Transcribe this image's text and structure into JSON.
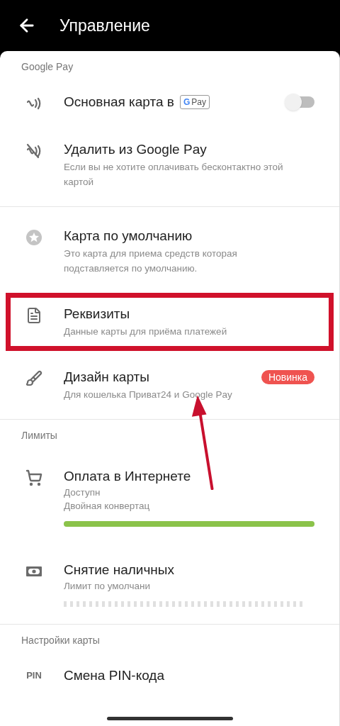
{
  "header": {
    "title": "Управление"
  },
  "sections": [
    {
      "title": "Google Pay",
      "items": [
        {
          "kind": "toggle",
          "title": "Основная карта в",
          "badge": {
            "g": "G",
            "text": "Pay"
          },
          "on": false
        },
        {
          "kind": "plain",
          "title": "Удалить из Google Pay",
          "subtitle": "Если вы не хотите оплачивать бесконтактно этой картой",
          "highlighted": false
        }
      ]
    },
    {
      "items": [
        {
          "kind": "plain",
          "title": "Карта по умолчанию",
          "subtitle": "Это карта для приема средств которая подставляется по умолчанию.",
          "highlighted": false
        },
        {
          "kind": "plain",
          "title": "Реквизиты",
          "subtitle": "Данные карты для приёма платежей",
          "highlighted": true
        },
        {
          "kind": "plain",
          "title": "Дизайн карты",
          "subtitle": "Для кошелька Приват24 и Google Pay",
          "tag": "Новинка",
          "highlighted": false
        }
      ]
    },
    {
      "title": "Лимиты",
      "items": [
        {
          "kind": "limit",
          "title": "Оплата в Интернете",
          "lines": [
            "Доступн",
            "Двойная конвертац"
          ],
          "loading": false,
          "level": 1
        },
        {
          "kind": "limit",
          "title": "Снятие наличных",
          "lines": [
            "Лимит по умолчани"
          ],
          "loading": true
        }
      ]
    },
    {
      "title": "Настройки карты",
      "items": [
        {
          "kind": "plain",
          "icon_text": "PIN",
          "title": "Смена PIN-кода",
          "highlighted": false
        }
      ]
    }
  ]
}
